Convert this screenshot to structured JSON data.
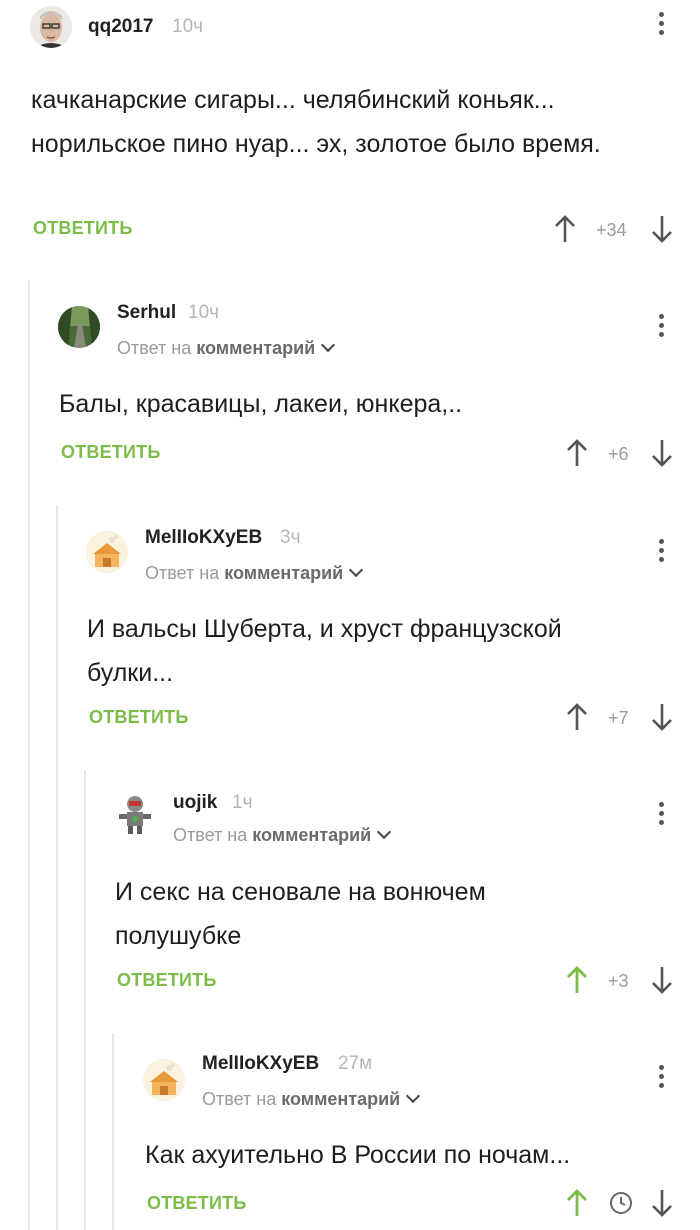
{
  "comments": [
    {
      "username": "qq2017",
      "time": "10ч",
      "text": "качканарские сигары... челябинский коньяк... норильское пино нуар... эх, золотое было время.",
      "reply_label": "ОТВЕТИТЬ",
      "rating": "+34",
      "upvoted": false
    },
    {
      "username": "Serhul",
      "time": "10ч",
      "reply_prefix": "Ответ на",
      "reply_target": "комментарий",
      "text": "Балы, красавицы, лакеи, юнкера,..",
      "reply_label": "ОТВЕТИТЬ",
      "rating": "+6",
      "upvoted": false
    },
    {
      "username": "MelIIoKXyEB",
      "time": "3ч",
      "reply_prefix": "Ответ на",
      "reply_target": "комментарий",
      "text": "И вальсы Шуберта, и хруст французской булки...",
      "reply_label": "ОТВЕТИТЬ",
      "rating": "+7",
      "upvoted": false
    },
    {
      "username": "uojik",
      "time": "1ч",
      "reply_prefix": "Ответ на",
      "reply_target": "комментарий",
      "text": "И секс на сеновале на вонючем полушубке",
      "reply_label": "ОТВЕТИТЬ",
      "rating": "+3",
      "upvoted": true
    },
    {
      "username": "MelIIoKXyEB",
      "time": "27м",
      "reply_prefix": "Ответ на",
      "reply_target": "комментарий",
      "text": "Как ахуительно В России по ночам...",
      "reply_label": "ОТВЕТИТЬ",
      "rating_icon": "clock-icon",
      "upvoted": true
    }
  ],
  "colors": {
    "accent_green": "#7bbd46",
    "thread_line": "#e6e6e6",
    "meta_gray": "#9a9a9a"
  }
}
